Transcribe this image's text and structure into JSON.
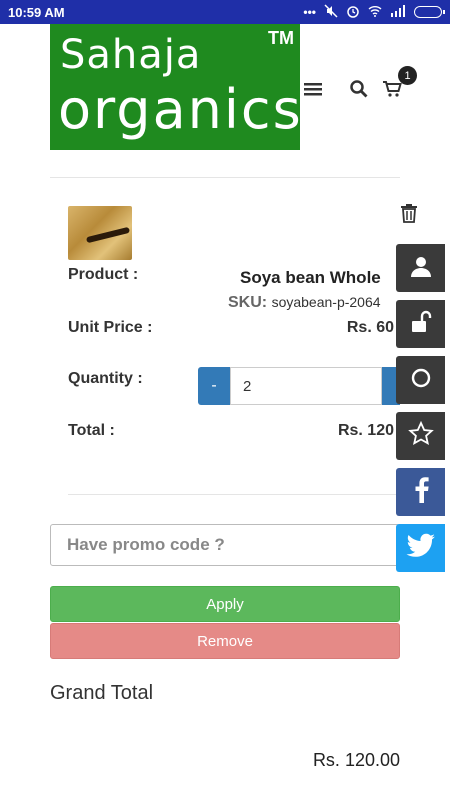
{
  "status_bar": {
    "time": "10:59 AM",
    "icons": [
      "dots-icon",
      "mute-icon",
      "alarm-icon",
      "wifi-icon",
      "signal-icon",
      "battery-icon"
    ]
  },
  "brand": {
    "line1": "Sahaja",
    "line2": "organics",
    "tm": "TM",
    "color": "#1f8a1f"
  },
  "header": {
    "cart_count": "1"
  },
  "cart_item": {
    "product_label": "Product :",
    "product_name": "Soya bean Whole",
    "sku_label": "SKU:",
    "sku_code": "soyabean-p-2064",
    "unit_price_label": "Unit Price :",
    "unit_price": "Rs. 60",
    "quantity_label": "Quantity :",
    "minus_label": "-",
    "quantity": "2",
    "total_label": "Total :",
    "total": "Rs. 120"
  },
  "promo": {
    "placeholder": "Have promo code ?",
    "apply_label": "Apply",
    "remove_label": "Remove"
  },
  "summary": {
    "grand_total_label": "Grand Total",
    "grand_total_value": "Rs. 120.00"
  },
  "side_buttons": [
    "user-icon",
    "unlock-icon",
    "circle-icon",
    "star-icon",
    "facebook-icon",
    "twitter-icon"
  ],
  "colors": {
    "status_bar": "#1f2fa8",
    "apply": "#5cb85c",
    "remove": "#e58a87",
    "qty_button": "#337ab7",
    "facebook": "#3b5998",
    "twitter": "#1da1f2"
  }
}
